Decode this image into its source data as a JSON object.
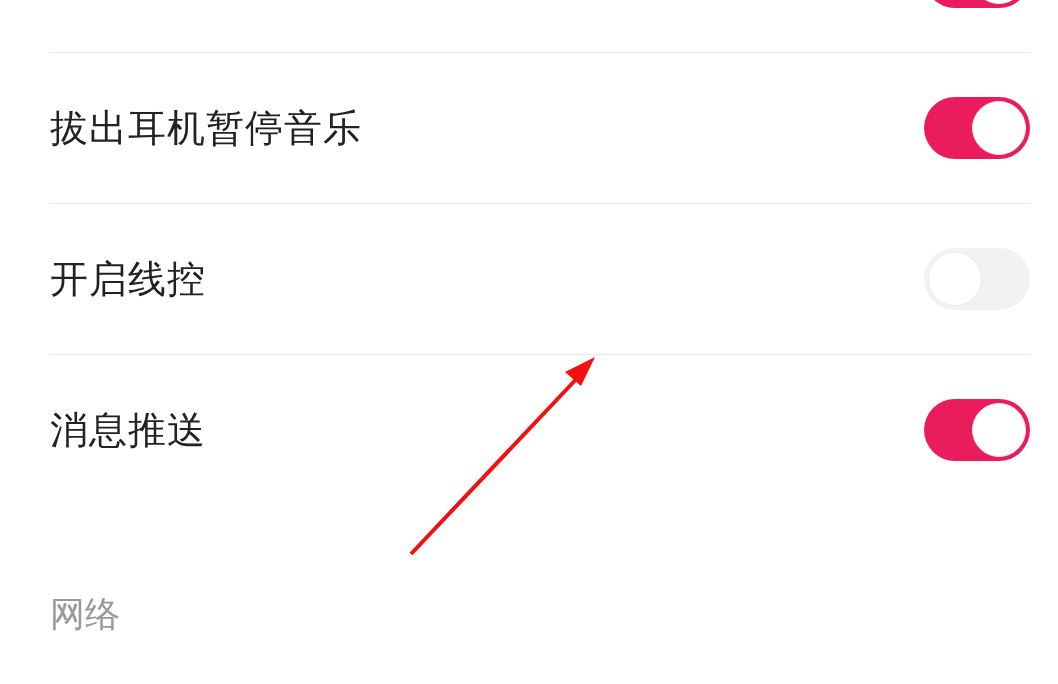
{
  "settings": [
    {
      "on": true
    },
    {
      "label": "拔出耳机暂停音乐",
      "on": true
    },
    {
      "label": "开启线控",
      "on": false
    },
    {
      "label": "消息推送",
      "on": true
    }
  ],
  "section": {
    "title": "网络"
  }
}
